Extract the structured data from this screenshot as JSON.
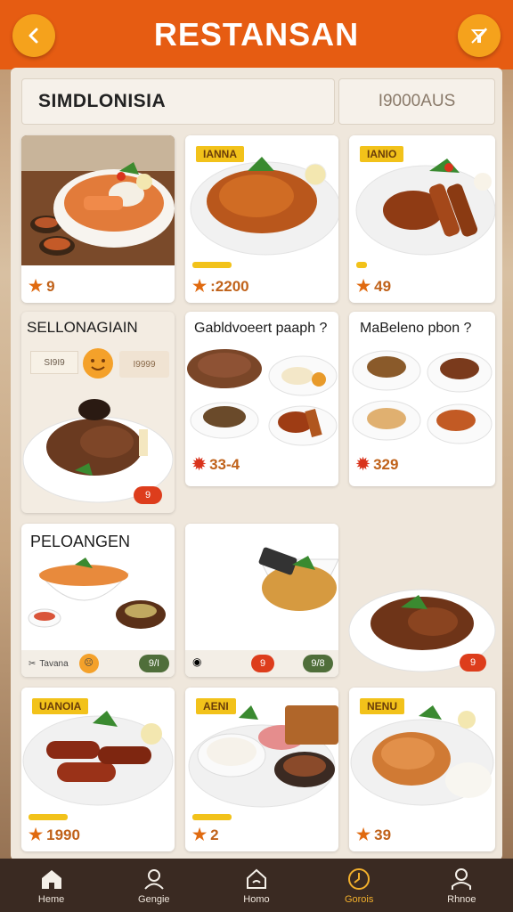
{
  "header": {
    "title": "RESTANSAN",
    "back_icon": "chevron-left-icon",
    "action_icon": "crossed-out-icon"
  },
  "search": {
    "label": "SIMDLONISIA",
    "price_filter": "I9000AUS"
  },
  "cards": {
    "soup": {
      "rating": "9"
    },
    "chicken": {
      "tag": "IANNA",
      "rating": ":2200"
    },
    "ribs": {
      "tag": "IANIO",
      "rating": "49"
    },
    "promo": {
      "title": "SELLONAGIAIN",
      "sub_left": "SI9I9",
      "sub_right": "I9999",
      "badge": "9"
    },
    "grid1": {
      "title": "Gabldvoeert paaph ?",
      "rating": "33-4"
    },
    "grid2": {
      "title": "MaBeleno pbon ?",
      "rating": "329"
    },
    "pelo": {
      "title": "PELOANGEN",
      "footer_label": "Tavana",
      "pill_green": "9/I"
    },
    "noodle": {
      "pill_red": "9",
      "pill_green": "9/8"
    },
    "duck": {
      "pill_red": "9"
    },
    "sausage": {
      "tag": "UANOIA",
      "rating": "1990"
    },
    "rice": {
      "tag": "AENI",
      "rating": "2"
    },
    "pork": {
      "tag": "NENU",
      "rating": "39"
    }
  },
  "nav": [
    {
      "label": "Heme",
      "icon": "home-icon"
    },
    {
      "label": "Gengie",
      "icon": "profile-search-icon"
    },
    {
      "label": "Homo",
      "icon": "house-outline-icon"
    },
    {
      "label": "Gorois",
      "icon": "clock-icon"
    },
    {
      "label": "Rhnoe",
      "icon": "user-icon"
    }
  ],
  "colors": {
    "header": "#e65c12",
    "accent": "#f5a21c",
    "nav_bg": "#3a2a22",
    "nav_active": "#f3b02c"
  }
}
